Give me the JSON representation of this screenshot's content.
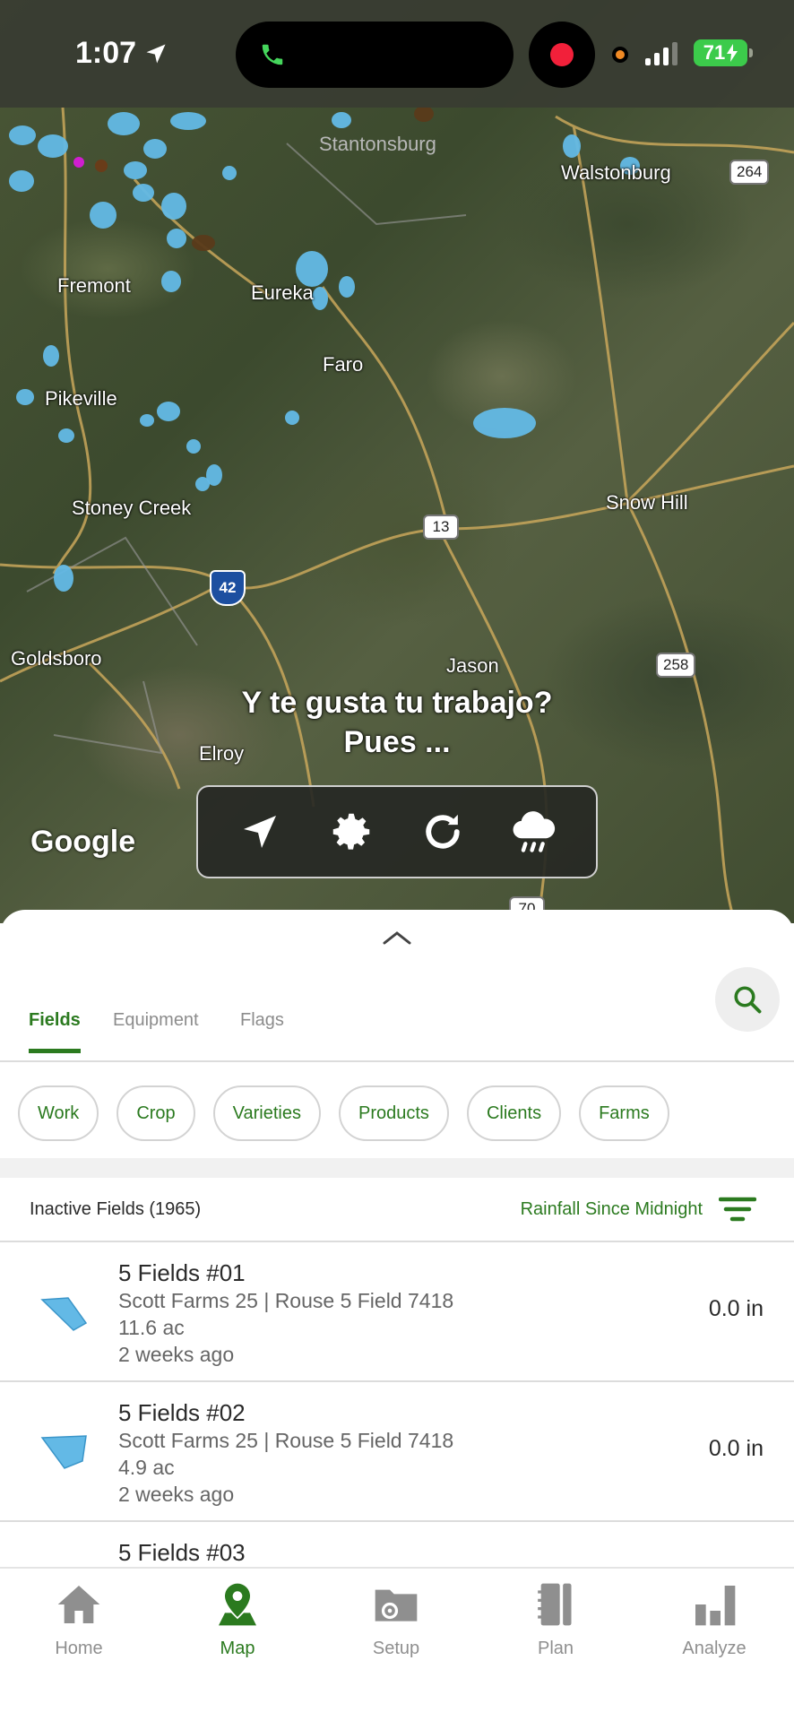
{
  "status_bar": {
    "time": "1:07",
    "battery": "71"
  },
  "map": {
    "places": {
      "stantonsburg": "Stantonsburg",
      "walstonburg": "Walstonburg",
      "fremont": "Fremont",
      "eureka": "Eureka",
      "faro": "Faro",
      "pikeville": "Pikeville",
      "stoney_creek": "Stoney Creek",
      "snow_hill": "Snow Hill",
      "goldsboro": "Goldsboro",
      "jason": "Jason",
      "elroy": "Elroy"
    },
    "shields": {
      "r264": "264",
      "r13": "13",
      "i42": "42",
      "r258": "258",
      "r70": "70"
    },
    "attribution": "Google",
    "caption_line1": "Y te gusta tu trabajo?",
    "caption_line2": "Pues ...",
    "toolbar_icons": [
      "location-arrow-icon",
      "gear-icon",
      "refresh-icon",
      "rain-cloud-icon"
    ]
  },
  "sheet": {
    "tabs": [
      {
        "label": "Fields",
        "active": true
      },
      {
        "label": "Equipment",
        "active": false
      },
      {
        "label": "Flags",
        "active": false
      }
    ],
    "chips": [
      "Work",
      "Crop",
      "Varieties",
      "Products",
      "Clients",
      "Farms"
    ],
    "list_header": {
      "count_label": "Inactive Fields (1965)",
      "sort_label": "Rainfall Since Midnight"
    },
    "fields": [
      {
        "name": "5 Fields #01",
        "farm": "Scott Farms 25 | Rouse 5 Field 7418",
        "acres": "11.6 ac",
        "updated": "2 weeks ago",
        "rain": "0.0 in"
      },
      {
        "name": "5 Fields #02",
        "farm": "Scott Farms 25 | Rouse 5 Field 7418",
        "acres": "4.9 ac",
        "updated": "2 weeks ago",
        "rain": "0.0 in"
      },
      {
        "name": "5 Fields #03"
      }
    ]
  },
  "tab_bar": [
    {
      "label": "Home",
      "icon": "home-icon",
      "active": false
    },
    {
      "label": "Map",
      "icon": "map-pin-icon",
      "active": true
    },
    {
      "label": "Setup",
      "icon": "folder-gear-icon",
      "active": false
    },
    {
      "label": "Plan",
      "icon": "notebook-icon",
      "active": false
    },
    {
      "label": "Analyze",
      "icon": "bar-chart-icon",
      "active": false
    }
  ],
  "colors": {
    "accent": "#2b7a1f",
    "field_shape": "#63b9e6",
    "battery": "#3ccb4b"
  }
}
